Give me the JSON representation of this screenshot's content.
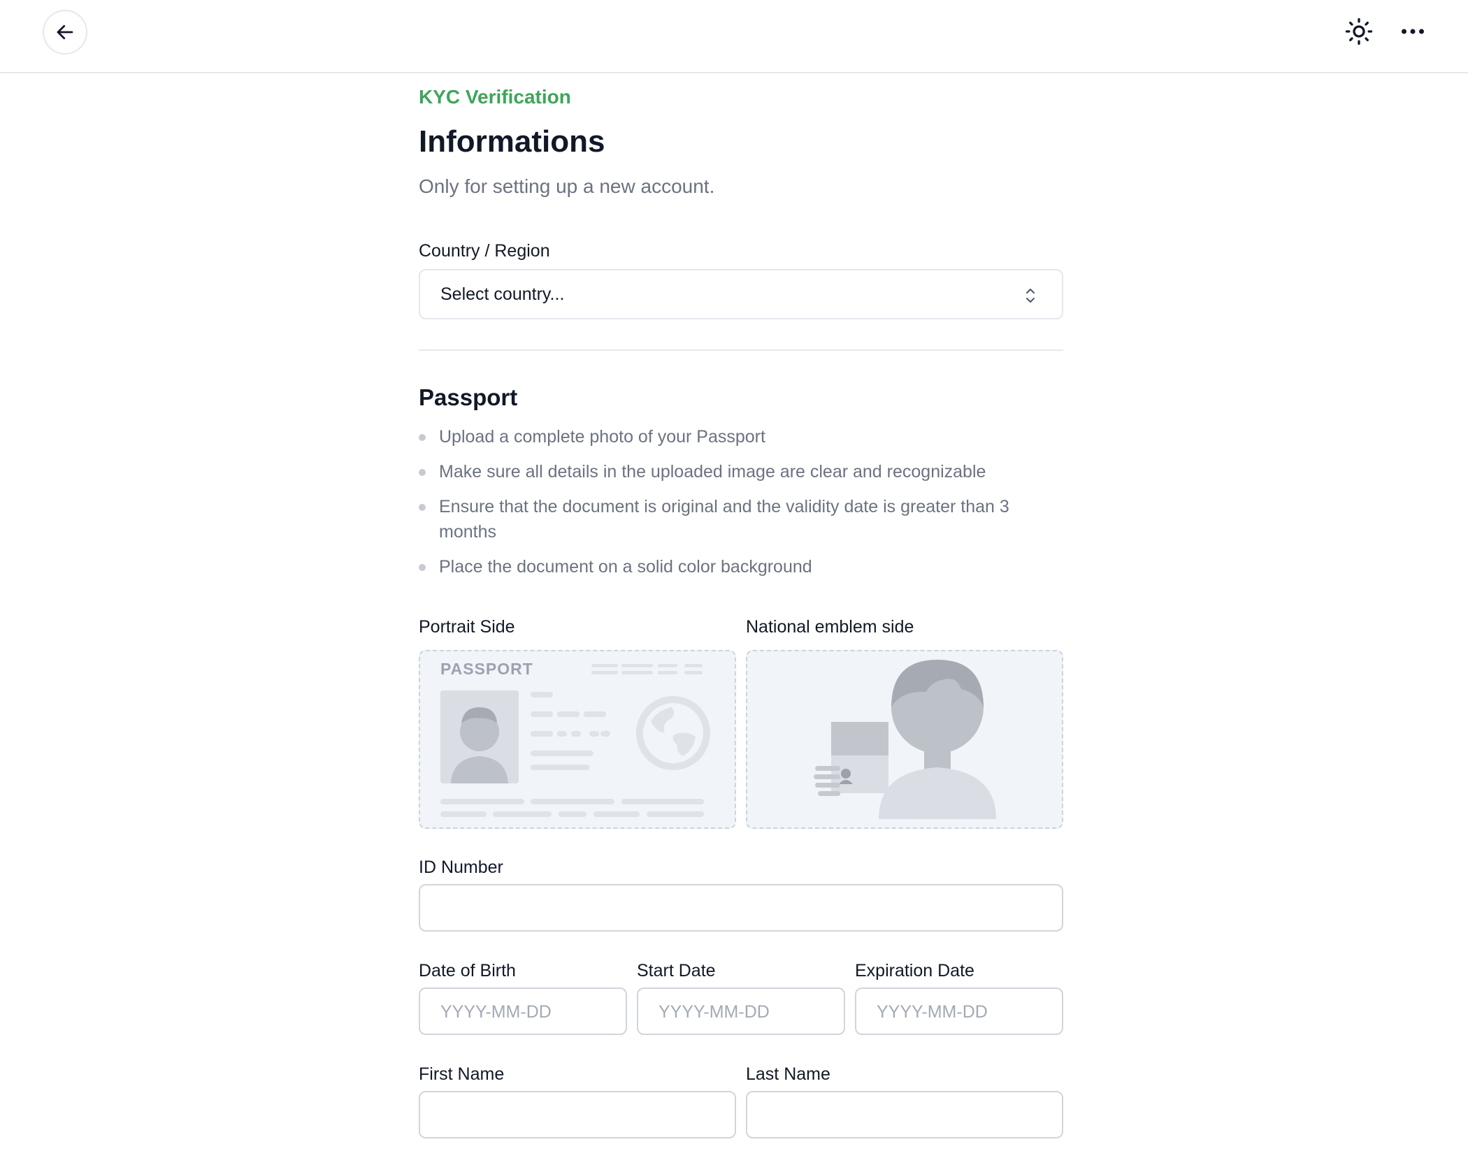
{
  "header": {
    "back_icon": "arrow-left-icon",
    "theme_icon": "sun-icon",
    "more_icon": "more-horizontal-icon"
  },
  "page": {
    "eyebrow": "KYC Verification",
    "title": "Informations",
    "subtitle": "Only for setting up a new account."
  },
  "country": {
    "label": "Country / Region",
    "value": "Select country..."
  },
  "passport": {
    "title": "Passport",
    "rules": [
      "Upload a complete photo of your Passport",
      "Make sure all details in the uploaded image are clear and recognizable",
      "Ensure that the document is original and the validity date is greater than 3 months",
      "Place the document on a solid color background"
    ],
    "portrait_label": "Portrait Side",
    "emblem_label": "National emblem side",
    "card_text": "PASSPORT"
  },
  "form": {
    "id_label": "ID Number",
    "dob_label": "Date of Birth",
    "start_label": "Start Date",
    "exp_label": "Expiration Date",
    "date_placeholder": "YYYY-MM-DD",
    "first_label": "First Name",
    "last_label": "Last Name"
  },
  "colors": {
    "accent": "#3fa55a",
    "text": "#111827",
    "muted": "#6b7280",
    "border": "#e5e7eb",
    "upload_bg": "#f1f4f9"
  }
}
